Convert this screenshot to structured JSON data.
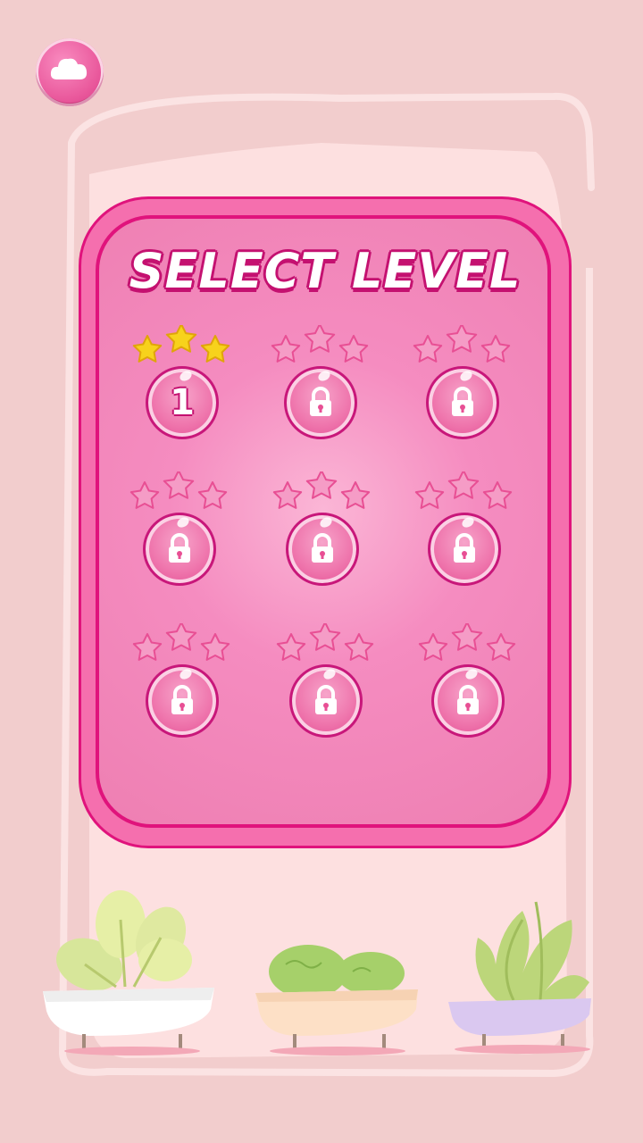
{
  "screen": {
    "title": "SELECT LEVEL"
  },
  "back_button": {
    "icon": "cloud-back-icon"
  },
  "levels": [
    {
      "label": "1",
      "locked": false,
      "stars_earned": 3
    },
    {
      "label": "",
      "locked": true,
      "stars_earned": 0
    },
    {
      "label": "",
      "locked": true,
      "stars_earned": 0
    },
    {
      "label": "",
      "locked": true,
      "stars_earned": 0
    },
    {
      "label": "",
      "locked": true,
      "stars_earned": 0
    },
    {
      "label": "",
      "locked": true,
      "stars_earned": 0
    },
    {
      "label": "",
      "locked": true,
      "stars_earned": 0
    },
    {
      "label": "",
      "locked": true,
      "stars_earned": 0
    },
    {
      "label": "",
      "locked": true,
      "stars_earned": 0
    }
  ],
  "colors": {
    "background": "#f2cdcd",
    "panel": "#f56fae",
    "panel_border": "#e0137c",
    "star_earned": "#f7d21c",
    "star_empty": "#f59cc6"
  },
  "decor": {
    "pots": [
      "white-pot-with-leafy-greens",
      "peach-pot-with-lettuce",
      "lavender-pot-with-oak-leaf-lettuce"
    ]
  }
}
